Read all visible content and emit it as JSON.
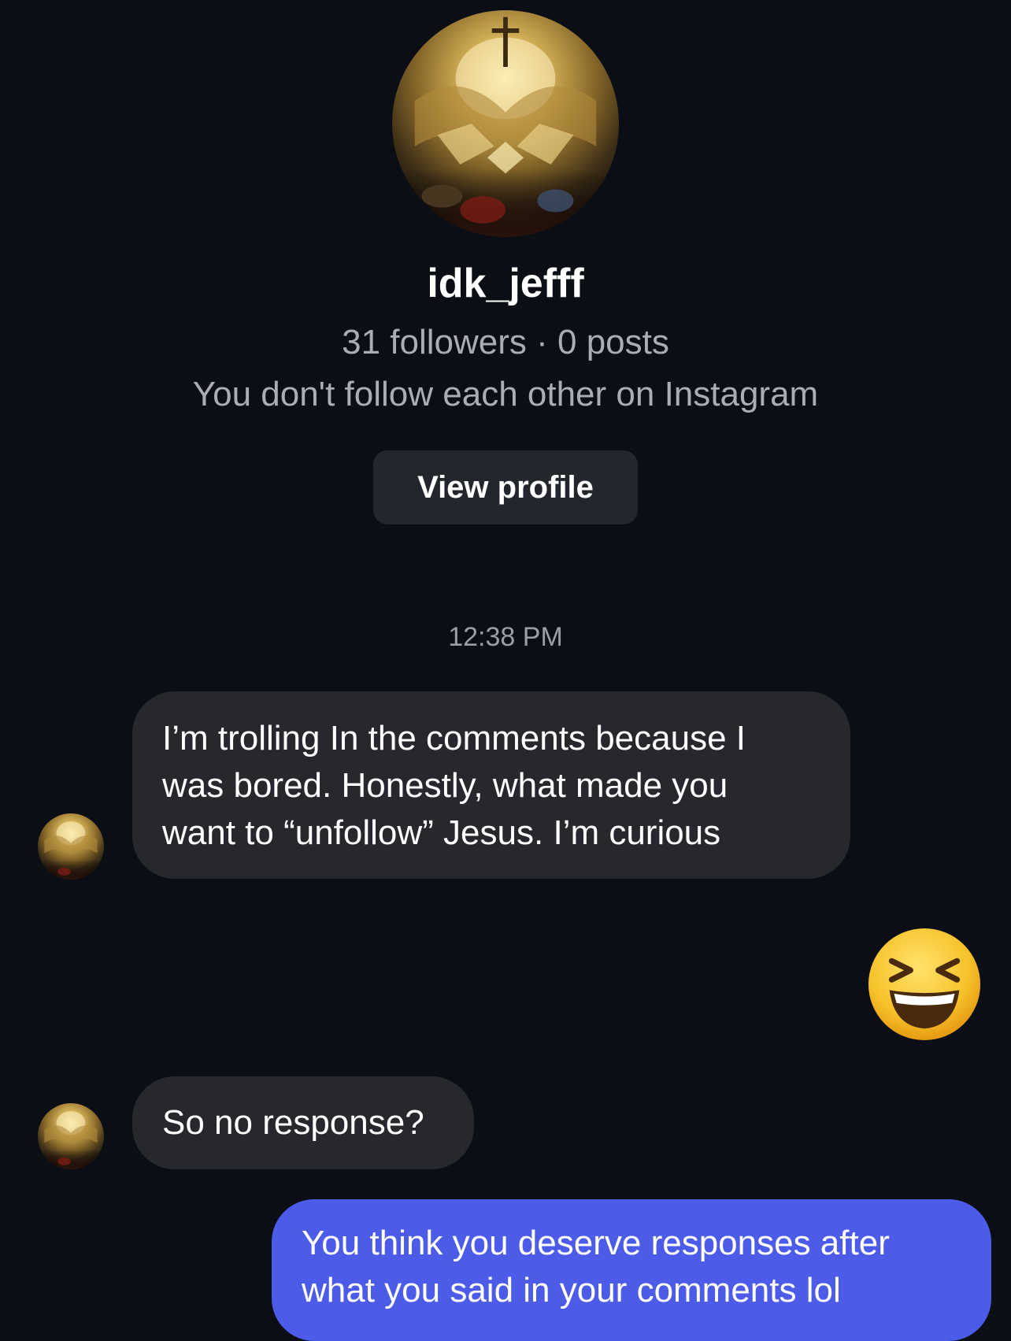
{
  "profile": {
    "username": "idk_jefff",
    "stats": "31 followers · 0 posts",
    "follow_note": "You don't follow each other on Instagram",
    "view_profile_label": "View profile",
    "avatar_icon": "painting-avatar"
  },
  "thread": {
    "timestamp": "12:38 PM",
    "messages": [
      {
        "direction": "incoming",
        "lines": [
          "I’m trolling In the comments because I",
          "was bored. Honestly, what made you",
          "want to “unfollow” Jesus. I’m curious"
        ]
      },
      {
        "direction": "outgoing",
        "emoji": "😆",
        "emoji_icon": "grinning-squinting-face-emoji"
      },
      {
        "direction": "incoming",
        "text": "So no response?"
      },
      {
        "direction": "outgoing",
        "lines": [
          "You think you deserve responses after",
          "what you said in your comments lol"
        ]
      }
    ]
  },
  "colors": {
    "background": "#0b0e14",
    "incoming_bubble": "#26282d",
    "outgoing_bubble": "#4c5be8",
    "secondary_text": "#a9adb4"
  }
}
